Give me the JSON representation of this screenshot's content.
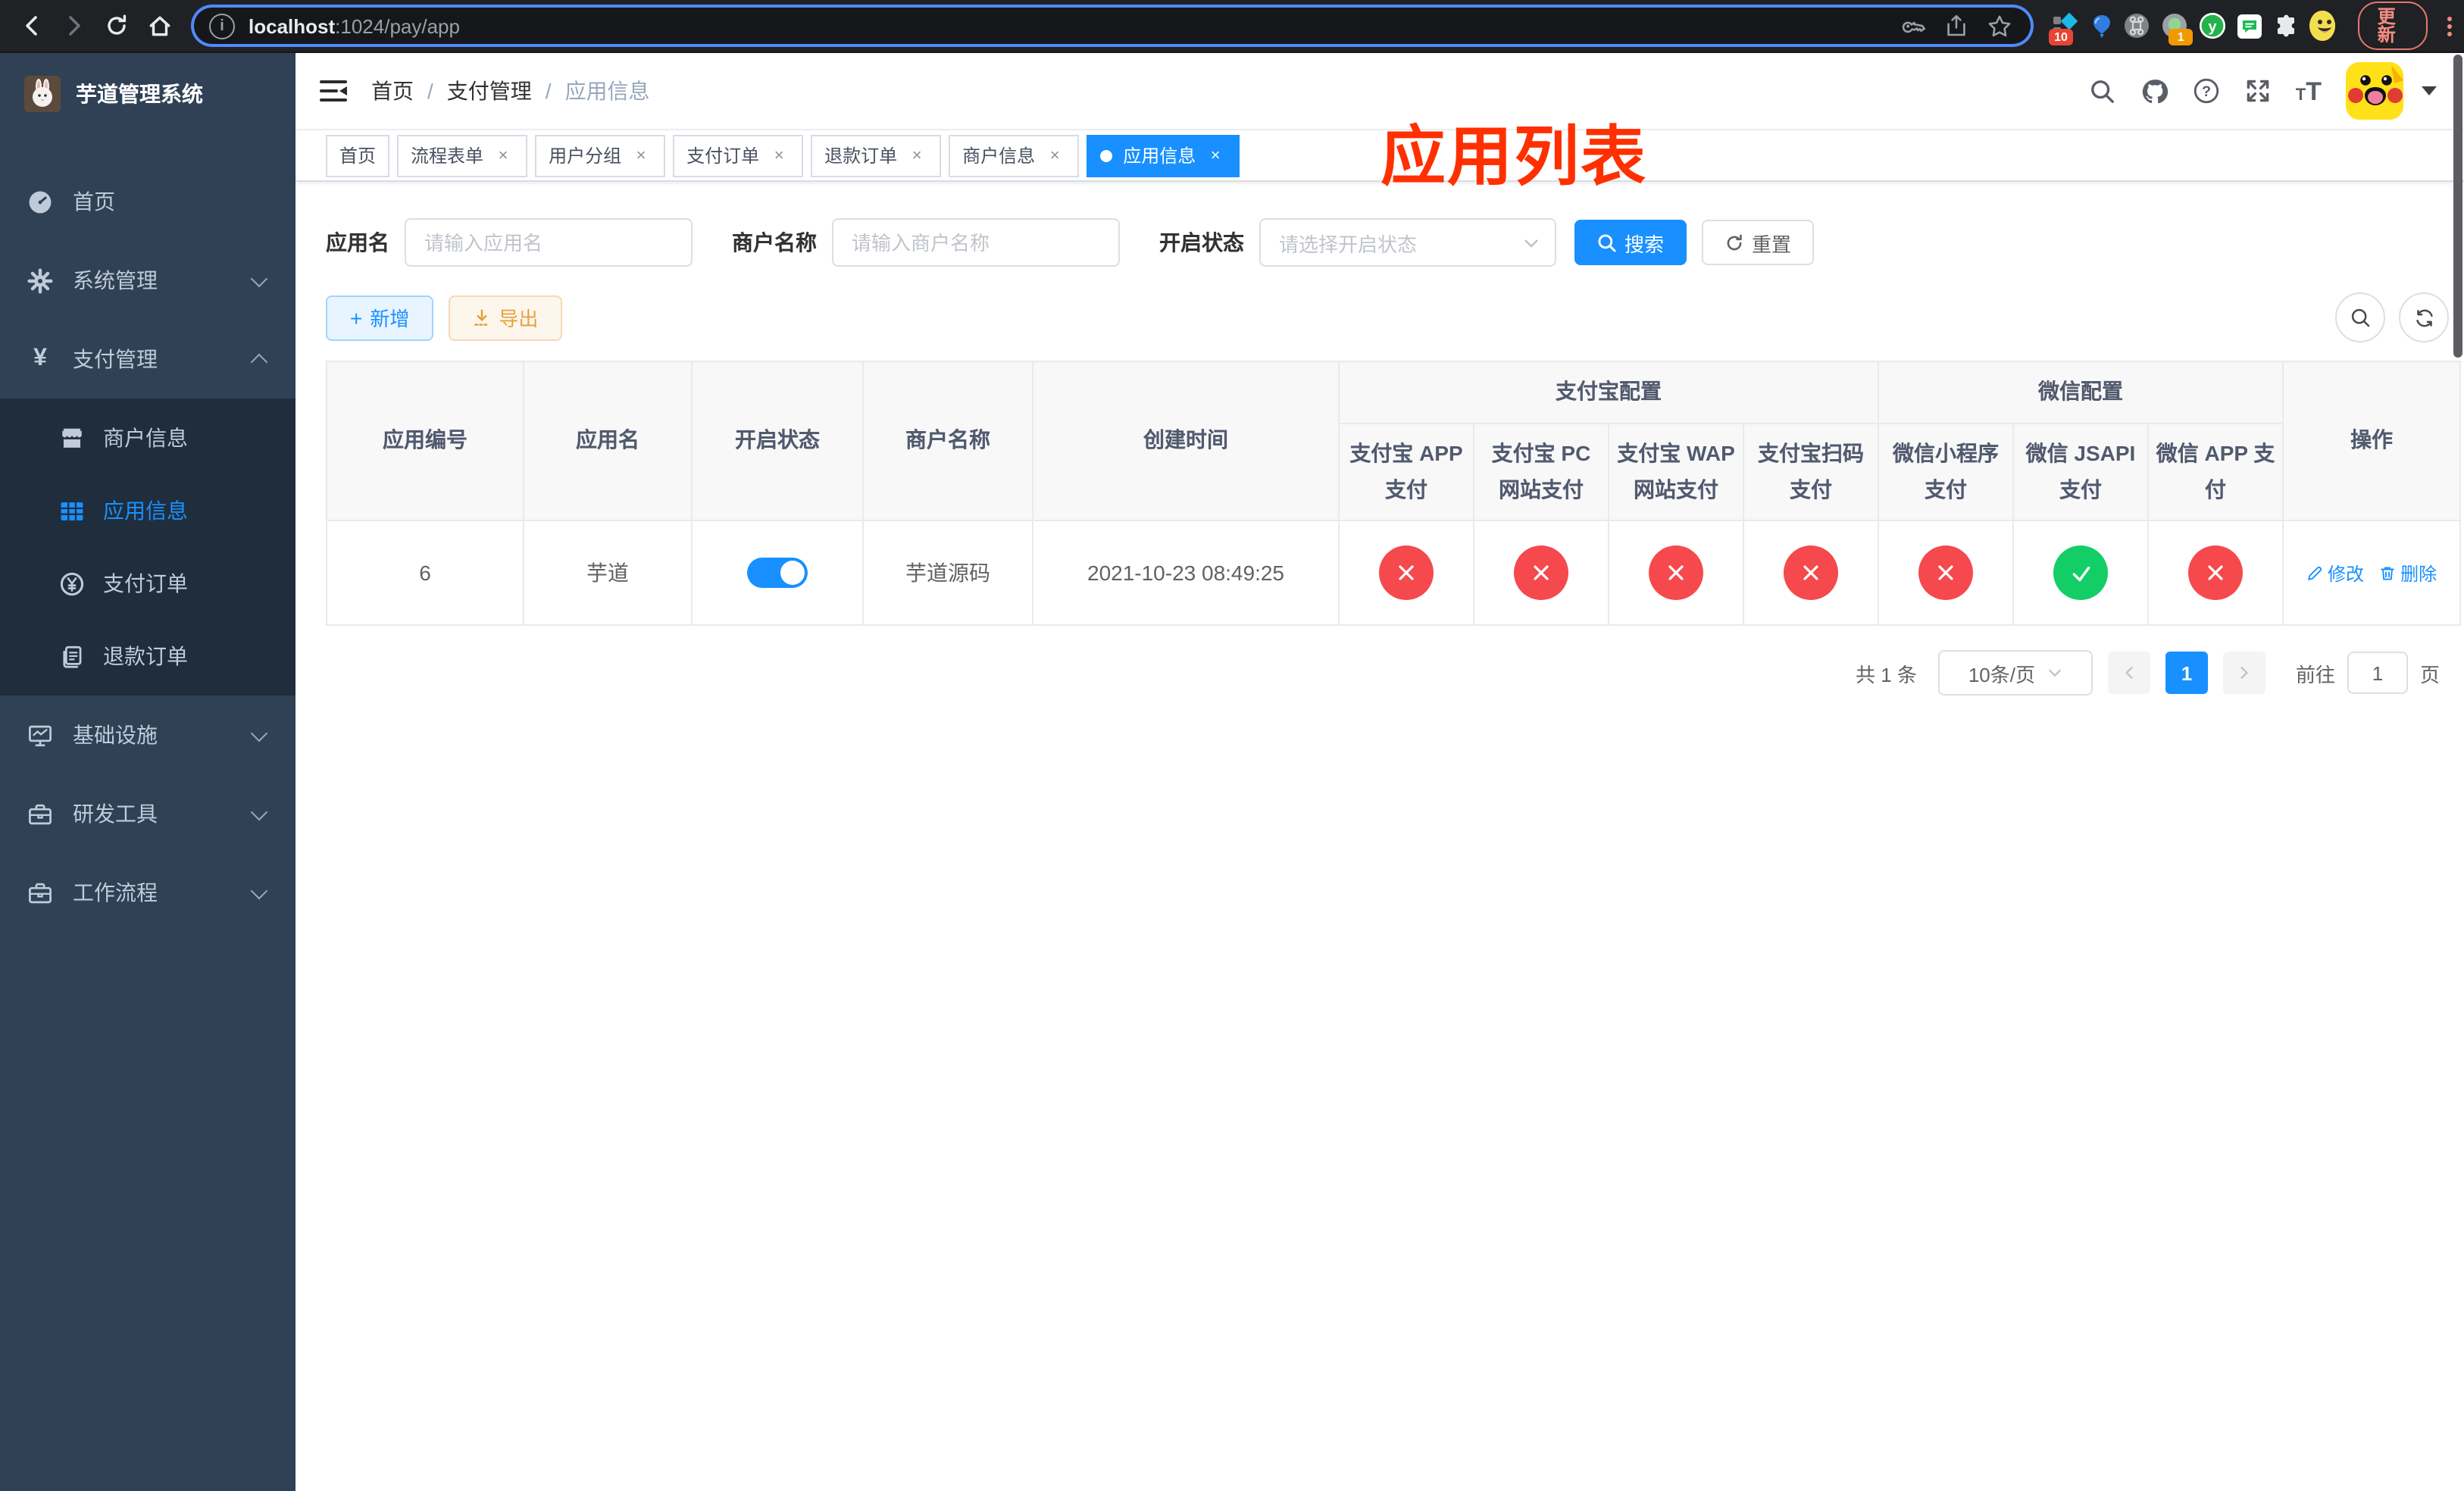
{
  "browser": {
    "url_host": "localhost",
    "url_rest": ":1024/pay/app",
    "ext_badge_a": "10",
    "ext_badge_b": "1",
    "update_label": "更新"
  },
  "sidebar": {
    "title": "芋道管理系统",
    "items": [
      {
        "label": "首页"
      },
      {
        "label": "系统管理"
      },
      {
        "label": "支付管理"
      },
      {
        "label": "商户信息"
      },
      {
        "label": "应用信息"
      },
      {
        "label": "支付订单"
      },
      {
        "label": "退款订单"
      },
      {
        "label": "基础设施"
      },
      {
        "label": "研发工具"
      },
      {
        "label": "工作流程"
      }
    ]
  },
  "navbar": {
    "breadcrumb": [
      "首页",
      "支付管理",
      "应用信息"
    ],
    "separator": "/"
  },
  "annotation": {
    "title": "应用列表",
    "color": "#ff3000"
  },
  "tabs": [
    {
      "label": "首页"
    },
    {
      "label": "流程表单"
    },
    {
      "label": "用户分组"
    },
    {
      "label": "支付订单"
    },
    {
      "label": "退款订单"
    },
    {
      "label": "商户信息"
    },
    {
      "label": "应用信息"
    }
  ],
  "filters": {
    "app_name_label": "应用名",
    "app_name_placeholder": "请输入应用名",
    "merchant_label": "商户名称",
    "merchant_placeholder": "请输入商户名称",
    "status_label": "开启状态",
    "status_placeholder": "请选择开启状态",
    "search_label": "搜索",
    "reset_label": "重置"
  },
  "toolbar": {
    "add_label": "新增",
    "export_label": "导出"
  },
  "table": {
    "columns": {
      "app_id": "应用编号",
      "app_name": "应用名",
      "open_status": "开启状态",
      "merchant_name": "商户名称",
      "create_time": "创建时间",
      "alipay_group": "支付宝配置",
      "wechat_group": "微信配置",
      "alipay_app": "支付宝 APP 支付",
      "alipay_pc": "支付宝 PC 网站支付",
      "alipay_wap": "支付宝 WAP 网站支付",
      "alipay_qr": "支付宝扫码支付",
      "wx_lite": "微信小程序支付",
      "wx_jsapi": "微信 JSAPI 支付",
      "wx_app": "微信 APP 支付",
      "actions": "操作"
    },
    "rows": [
      {
        "app_id": "6",
        "app_name": "芋道",
        "open_status": true,
        "merchant_name": "芋道源码",
        "create_time": "2021-10-23 08:49:25",
        "alipay_app": false,
        "alipay_pc": false,
        "alipay_wap": false,
        "alipay_qr": false,
        "wx_lite": false,
        "wx_jsapi": true,
        "wx_app": false,
        "edit_label": "修改",
        "delete_label": "删除"
      }
    ]
  },
  "pagination": {
    "total_text": "共 1 条",
    "page_size": "10条/页",
    "current_page": "1",
    "goto_label": "前往",
    "goto_value": "1",
    "goto_suffix": "页"
  },
  "colors": {
    "primary": "#1890ff",
    "success": "#13ce66",
    "danger": "#f5494d",
    "warning": "#e6a23c"
  }
}
